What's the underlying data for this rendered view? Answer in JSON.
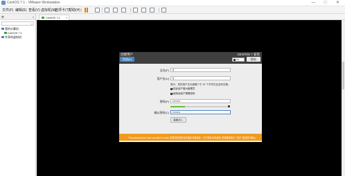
{
  "window": {
    "title": "CentOS 7.1 - VMware Workstation",
    "controls": {
      "minimize": "—",
      "maximize": "□",
      "close": "✕"
    }
  },
  "menubar": {
    "items": [
      "文件(F)",
      "编辑(E)",
      "查看(V)",
      "虚拟机(M)",
      "选项卡(T)",
      "帮助(H)"
    ]
  },
  "toolbar": {
    "icons": [
      "pause-icon",
      "send-keys-icon",
      "snapshot-icon",
      "revert-icon",
      "snapshot-manager-icon",
      "fullscreen-icon",
      "unity-icon",
      "console-icon",
      "stretch-icon"
    ]
  },
  "library": {
    "title": "库",
    "close": "×",
    "search_placeholder": "",
    "tree": [
      {
        "label": "我的计算机",
        "type": "folder"
      },
      {
        "label": "CentOS 7.1",
        "type": "vm"
      },
      {
        "label": "共享的虚拟机",
        "type": "folder"
      }
    ]
  },
  "tabs": [
    {
      "label": "CentOS 7.1",
      "close": "×"
    }
  ],
  "installer": {
    "title": "创建用户",
    "done_label": "完成(D)",
    "brand": "CENTOS 7 安装",
    "keyboard": "cn",
    "help_label": "帮助!",
    "fields": {
      "fullname": {
        "label": "全名(F)",
        "value": "lj"
      },
      "username": {
        "label": "用户名(U)",
        "value": "lj"
      },
      "password": {
        "label": "密码(P)",
        "value": "••••••••"
      },
      "confirm": {
        "label": "确认密码(C)",
        "value": "••••••••"
      }
    },
    "hint": "提示：您的用户名长度要少于 32 个字符并且没有空格。",
    "checkbox_admin": "将此用户做为管理员",
    "checkbox_require_pw": "使用此帐户需要密码",
    "password_strength": 0.25,
    "advanced_label": "高级(A)...",
    "warning": "The password you have provided is weak: 您提供的密码没有通过字典检查 - 过于简单化/系统化 您需要按两次 \"完成\" 按钮进行确认。"
  }
}
